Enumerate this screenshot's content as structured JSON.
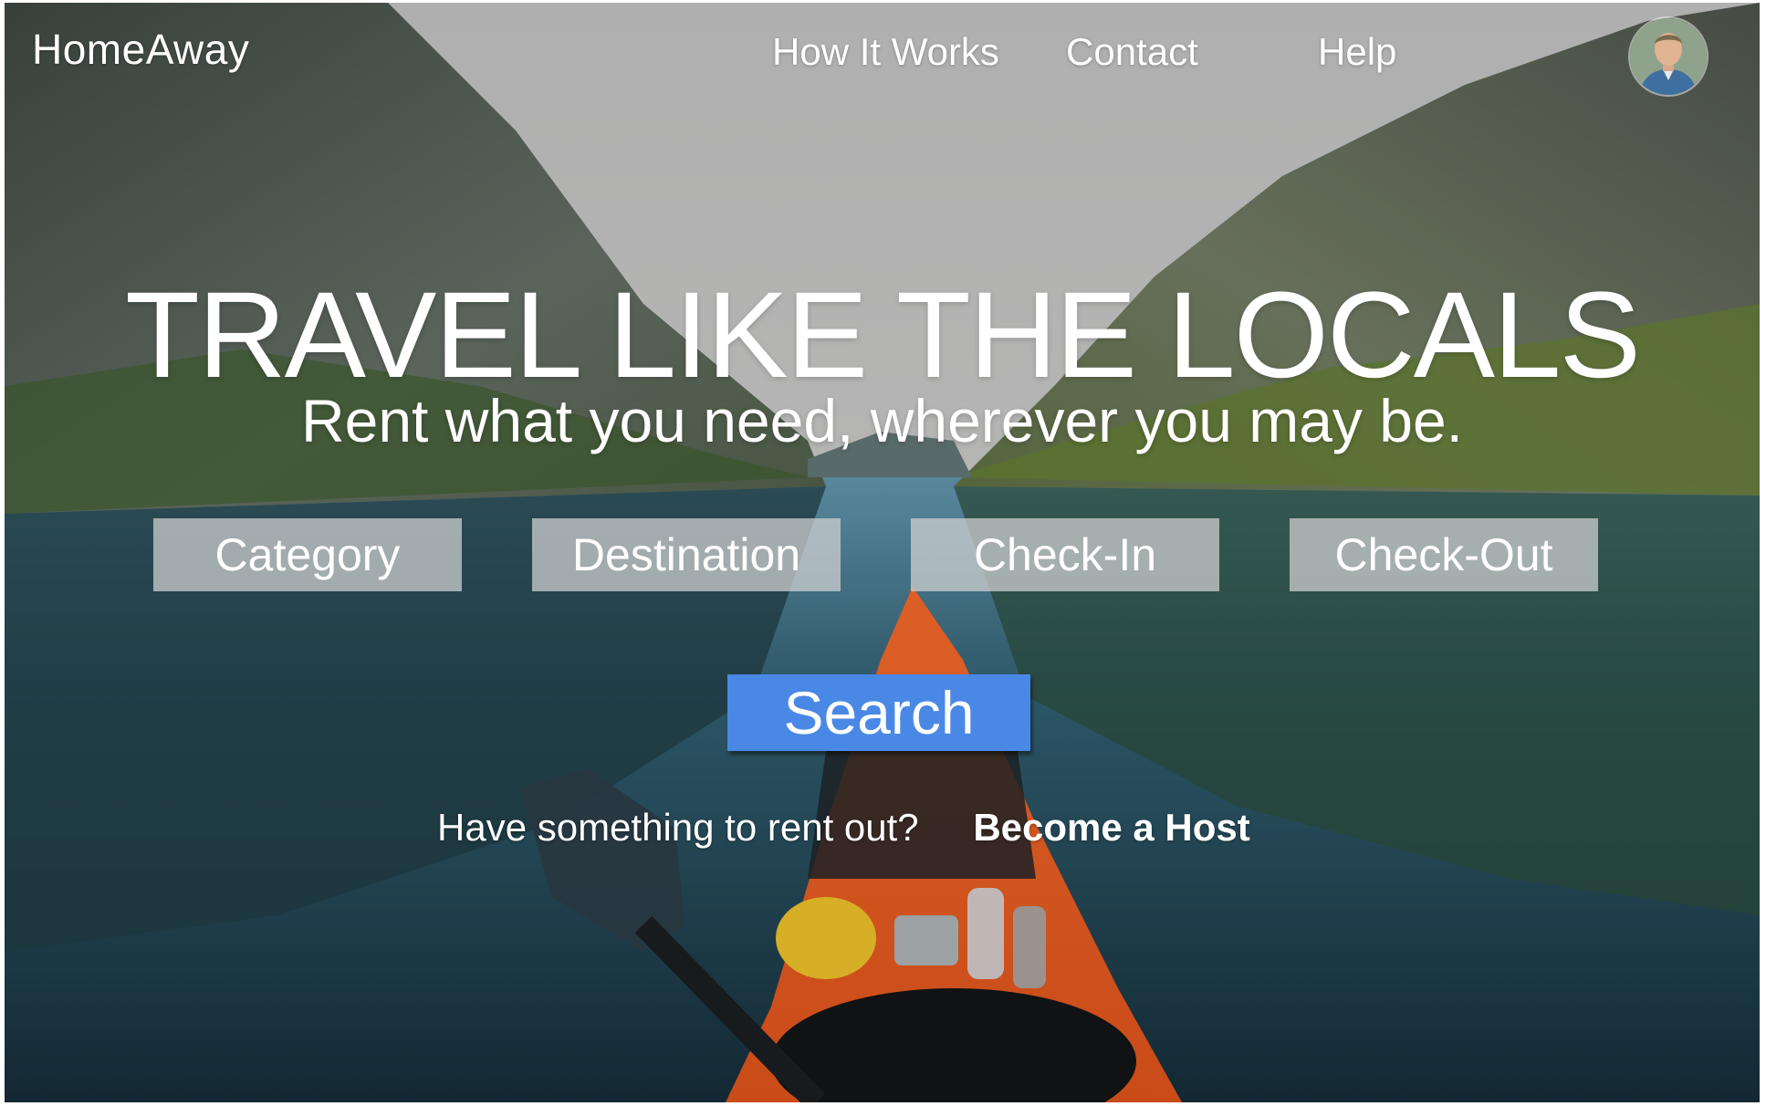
{
  "brand": {
    "logo_text": "HomeAway"
  },
  "nav": {
    "items": [
      {
        "label": "How It Works"
      },
      {
        "label": "Contact"
      },
      {
        "label": "Help"
      }
    ],
    "avatar_icon": "user-avatar"
  },
  "hero": {
    "headline": "TRAVEL LIKE THE LOCALS",
    "subheadline": "Rent what you need, wherever you may be."
  },
  "search": {
    "fields": [
      {
        "label": "Category"
      },
      {
        "label": "Destination"
      },
      {
        "label": "Check-In"
      },
      {
        "label": "Check-Out"
      }
    ],
    "button_label": "Search",
    "button_color": "#4a88e6"
  },
  "host": {
    "question": "Have something to rent out?",
    "link_label": "Become a Host"
  }
}
